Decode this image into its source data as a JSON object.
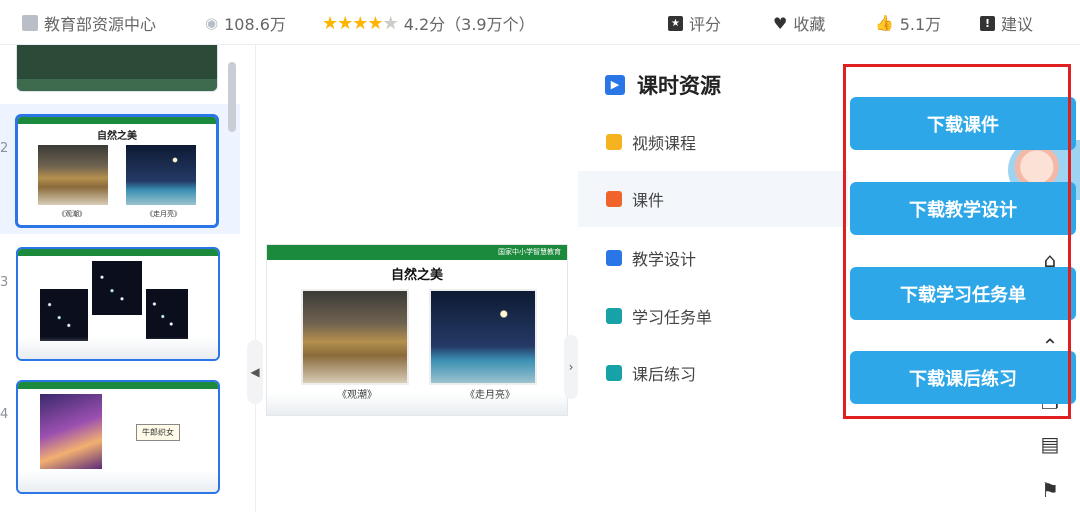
{
  "topbar": {
    "source": "教育部资源中心",
    "views": "108.6万",
    "rating": 4.2,
    "rating_text": "4.2分（3.9万个）",
    "rate_label": "评分",
    "fav_label": "收藏",
    "likes": "5.1万",
    "suggest_label": "建议"
  },
  "thumbnails": [
    {
      "num": "2",
      "title": "自然之美",
      "captions": [
        "《观潮》",
        "《走月亮》"
      ],
      "active": true
    },
    {
      "num": "3",
      "title": "",
      "active": false
    },
    {
      "num": "4",
      "title": "",
      "box_text": "牛郎织女",
      "active": false
    }
  ],
  "slide": {
    "header": "国家中小学智慧教育",
    "title": "自然之美",
    "captions": [
      "《观潮》",
      "《走月亮》"
    ]
  },
  "resources": {
    "title": "课时资源",
    "items": [
      {
        "label": "视频课程",
        "color": "#f5b320"
      },
      {
        "label": "课件",
        "color": "#f0632a",
        "active": true
      },
      {
        "label": "教学设计",
        "color": "#2a76e6"
      },
      {
        "label": "学习任务单",
        "color": "#17a2a8"
      },
      {
        "label": "课后练习",
        "color": "#17a2a8"
      }
    ]
  },
  "downloads": [
    "下载课件",
    "下载教学设计",
    "下载学习任务单",
    "下载课后练习"
  ],
  "colors": {
    "accent": "#2ea7e8",
    "highlight": "#e02020",
    "selected": "#2a76e6"
  }
}
